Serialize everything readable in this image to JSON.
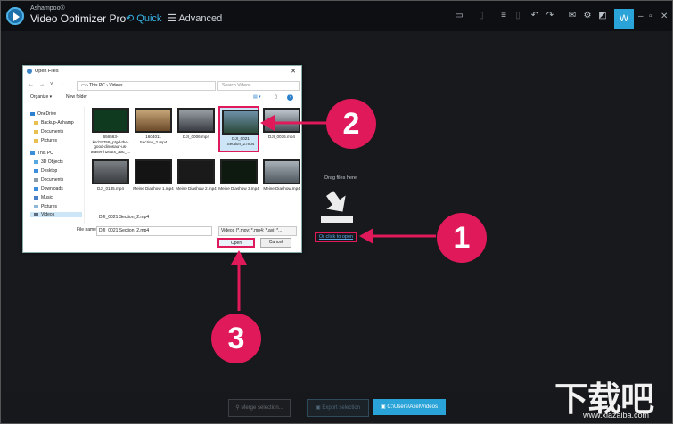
{
  "app": {
    "brand_small": "Ashampoo®",
    "brand_name": "Video Optimizer Pro",
    "nav_quick": "Quick",
    "nav_advanced": "Advanced",
    "user_button": "W"
  },
  "dropzone": {
    "drag_text": "Drag files here",
    "click_to_open": "Or click to open"
  },
  "bottom": {
    "merge": "Merge selection...",
    "export": "Export selection",
    "output_path": "C:\\Users\\Axel\\Videos"
  },
  "badges": {
    "one": "1",
    "two": "2",
    "three": "3"
  },
  "dialog": {
    "title": "Open Files",
    "close": "✕",
    "path_pc": "This PC",
    "path_sep": "›",
    "path_folder": "Videos",
    "search_placeholder": "Search Videos",
    "organize": "Organize ▾",
    "new_folder": "New folder",
    "sidebar": [
      {
        "label": "OneDrive"
      },
      {
        "label": "Backup-Ashamp"
      },
      {
        "label": "Documents"
      },
      {
        "label": "Pictures"
      },
      {
        "label": "This PC"
      },
      {
        "label": "3D Objects"
      },
      {
        "label": "Desktop"
      },
      {
        "label": "Documents"
      },
      {
        "label": "Downloads"
      },
      {
        "label": "Music"
      },
      {
        "label": "Pictures"
      },
      {
        "label": "Videos"
      }
    ],
    "files": [
      {
        "name": "656563-ksd19759_ptgd-the-good-dinosaur-us-teaser-h264ts_aac_..."
      },
      {
        "name": "1604011 Section_2.mp4"
      },
      {
        "name": "DJI_0006.mp4"
      },
      {
        "name": "DJI_0021 Section_2.mp4"
      },
      {
        "name": "DJI_0036.mp4"
      },
      {
        "name": "DJI_0135.mp4"
      },
      {
        "name": "Meine Diashow 1.mp4"
      },
      {
        "name": "Meine Diashow 2.mp4"
      },
      {
        "name": "Meine Diashow 3.mp4"
      },
      {
        "name": "Meine Diashow.mp4"
      }
    ],
    "selected_caption": "DJI_0021 Section_2.mp4",
    "filename_label": "File name:",
    "filename_value": "DJI_0021 Section_2.mp4",
    "filetype_value": "Videos (*.mov; *.mp4; *.avi; *...",
    "open": "Open",
    "cancel": "Cancel"
  },
  "watermark": {
    "cn": "下载吧",
    "url": "www.xiazaiba.com"
  },
  "colors": {
    "accent": "#2aa3d8",
    "highlight": "#e0195a",
    "background": "#17191c"
  }
}
